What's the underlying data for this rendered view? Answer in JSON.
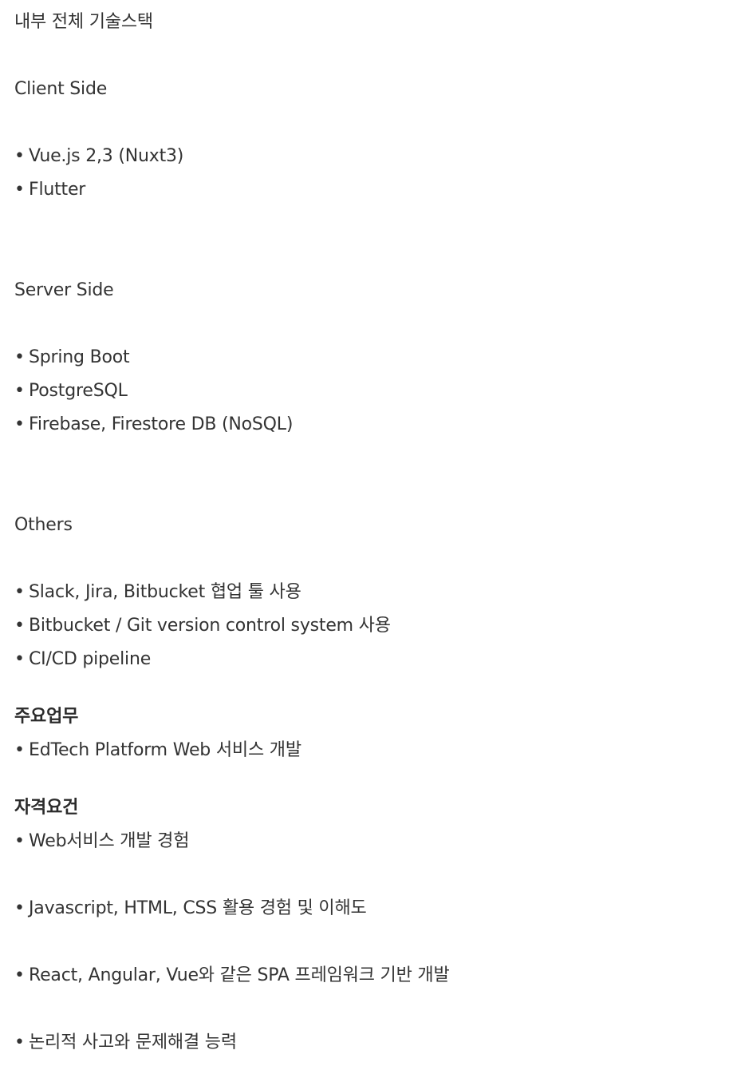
{
  "doc": {
    "stack_heading": "내부 전체 기술스택",
    "client": {
      "label": "Client Side",
      "items": [
        "Vue.js 2,3 (Nuxt3)",
        "Flutter"
      ]
    },
    "server": {
      "label": "Server Side",
      "items": [
        "Spring Boot",
        "PostgreSQL",
        "Firebase, Firestore DB (NoSQL)"
      ]
    },
    "others": {
      "label": "Others",
      "items": [
        "Slack, Jira, Bitbucket 협업 툴 사용",
        "Bitbucket / Git version control system 사용",
        "CI/CD pipeline"
      ]
    },
    "duties": {
      "label": "주요업무",
      "items": [
        "EdTech Platform Web 서비스 개발"
      ]
    },
    "requirements": {
      "label": "자격요건",
      "items": [
        "Web서비스 개발 경험",
        "Javascript, HTML, CSS 활용 경험 및 이해도",
        "React, Angular, Vue와 같은 SPA 프레임워크 기반 개발",
        "논리적 사고와 문제해결 능력"
      ]
    },
    "bullet_char": "•"
  }
}
